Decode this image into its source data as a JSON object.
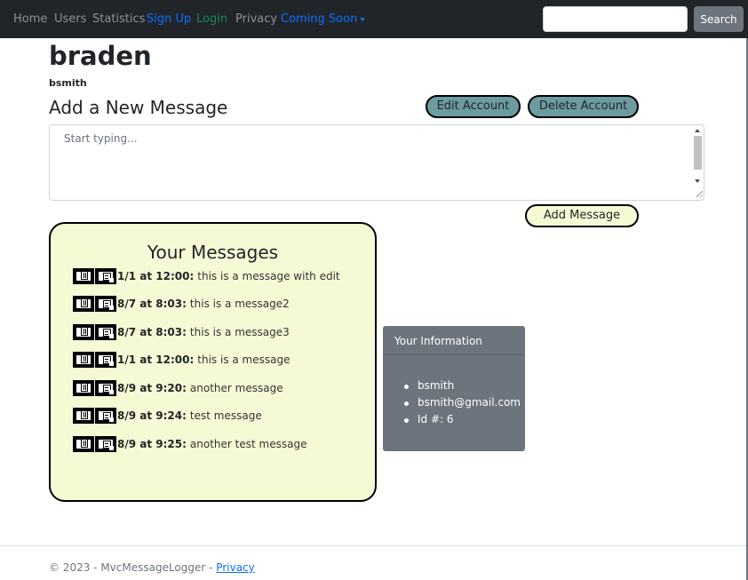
{
  "nav": {
    "links": [
      {
        "label": "Home"
      },
      {
        "label": "Users"
      },
      {
        "label": "Statistics"
      },
      {
        "label": "Sign Up"
      },
      {
        "label": "Login"
      },
      {
        "label": "Privacy"
      },
      {
        "label": "Coming Soon"
      }
    ],
    "search_value": "",
    "search_button": "Search"
  },
  "profile": {
    "display_name": "braden",
    "username": "bsmith"
  },
  "composer": {
    "heading": "Add a New Message",
    "placeholder": "Start typing...",
    "value": "",
    "edit_account_label": "Edit Account",
    "delete_account_label": "Delete Account",
    "add_message_label": "Add Message"
  },
  "messages": {
    "title": "Your Messages",
    "items": [
      {
        "time": "1/1 at 12:00:",
        "text": "this is a message with edit"
      },
      {
        "time": "8/7 at 8:03:",
        "text": "this is a message2"
      },
      {
        "time": "8/7 at 8:03:",
        "text": "this is a message3"
      },
      {
        "time": "1/1 at 12:00:",
        "text": "this is a message"
      },
      {
        "time": "8/9 at 9:20:",
        "text": "another message"
      },
      {
        "time": "8/9 at 9:24:",
        "text": "test message"
      },
      {
        "time": "8/9 at 9:25:",
        "text": "another test message"
      }
    ],
    "icons": {
      "delete": "trash-icon",
      "edit": "edit-note-icon"
    }
  },
  "info": {
    "title": "Your Information",
    "username": "bsmith",
    "email": "bsmith@gmail.com",
    "id_line": "Id #: 6"
  },
  "footer": {
    "text": "© 2023 - MvcMessageLogger - ",
    "link": "Privacy"
  },
  "colors": {
    "navbar": "#212529",
    "account_buttons": "#6c9ba0",
    "message_panel": "#f5fad5",
    "info_card": "#6c757d",
    "link_blue": "#0d6efd",
    "link_green": "#198754"
  }
}
